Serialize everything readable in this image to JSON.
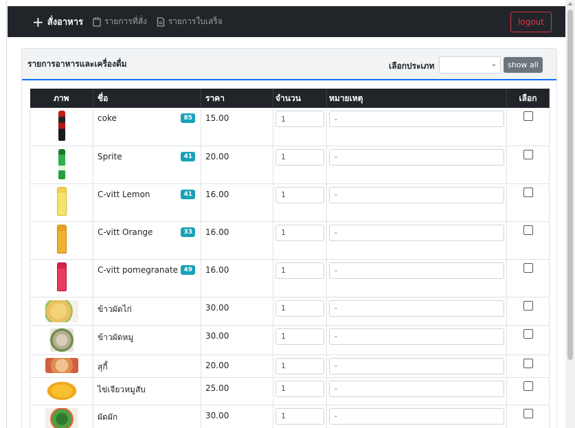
{
  "nav": {
    "brand_icon": "plus-icon",
    "brand_label": "สั่งอาหาร",
    "orders_label": "รายการที่สั่ง",
    "receipts_label": "รายการใบเสร็จ",
    "logout_label": "logout"
  },
  "card": {
    "title": "รายการอาหารและเครื่องดื่ม",
    "filter_label": "เลือกประเภท",
    "filter_selected": "",
    "show_all_label": "show all"
  },
  "table": {
    "headers": {
      "image": "ภาพ",
      "name": "ชื่อ",
      "price": "ราคา",
      "qty": "จำนวน",
      "note": "หมายเหตุ",
      "select": "เลือก"
    },
    "rows": [
      {
        "name": "coke",
        "badge": "85",
        "price": "15.00",
        "qty": "1",
        "note": "-"
      },
      {
        "name": "Sprite",
        "badge": "41",
        "price": "20.00",
        "qty": "1",
        "note": "-"
      },
      {
        "name": "C-vitt Lemon",
        "badge": "41",
        "price": "16.00",
        "qty": "1",
        "note": "-"
      },
      {
        "name": "C-vitt Orange",
        "badge": "33",
        "price": "16.00",
        "qty": "1",
        "note": "-"
      },
      {
        "name": "C-vitt pomegranate",
        "badge": "49",
        "price": "16.00",
        "qty": "1",
        "note": "-"
      },
      {
        "name": "ข้าวผัดไก่",
        "badge": "",
        "price": "30.00",
        "qty": "1",
        "note": "-"
      },
      {
        "name": "ข้าวผัดหมู",
        "badge": "",
        "price": "30.00",
        "qty": "1",
        "note": "-"
      },
      {
        "name": "สุกี้",
        "badge": "",
        "price": "20.00",
        "qty": "1",
        "note": "-"
      },
      {
        "name": "ไข่เจียวหมูสับ",
        "badge": "",
        "price": "25.00",
        "qty": "1",
        "note": "-"
      },
      {
        "name": "ผัดผัก",
        "badge": "",
        "price": "30.00",
        "qty": "1",
        "note": "-"
      }
    ]
  },
  "colors": {
    "navbar": "#212529",
    "accent": "#0d6efd",
    "badge": "#17a2b8",
    "logout": "#dc3545"
  }
}
